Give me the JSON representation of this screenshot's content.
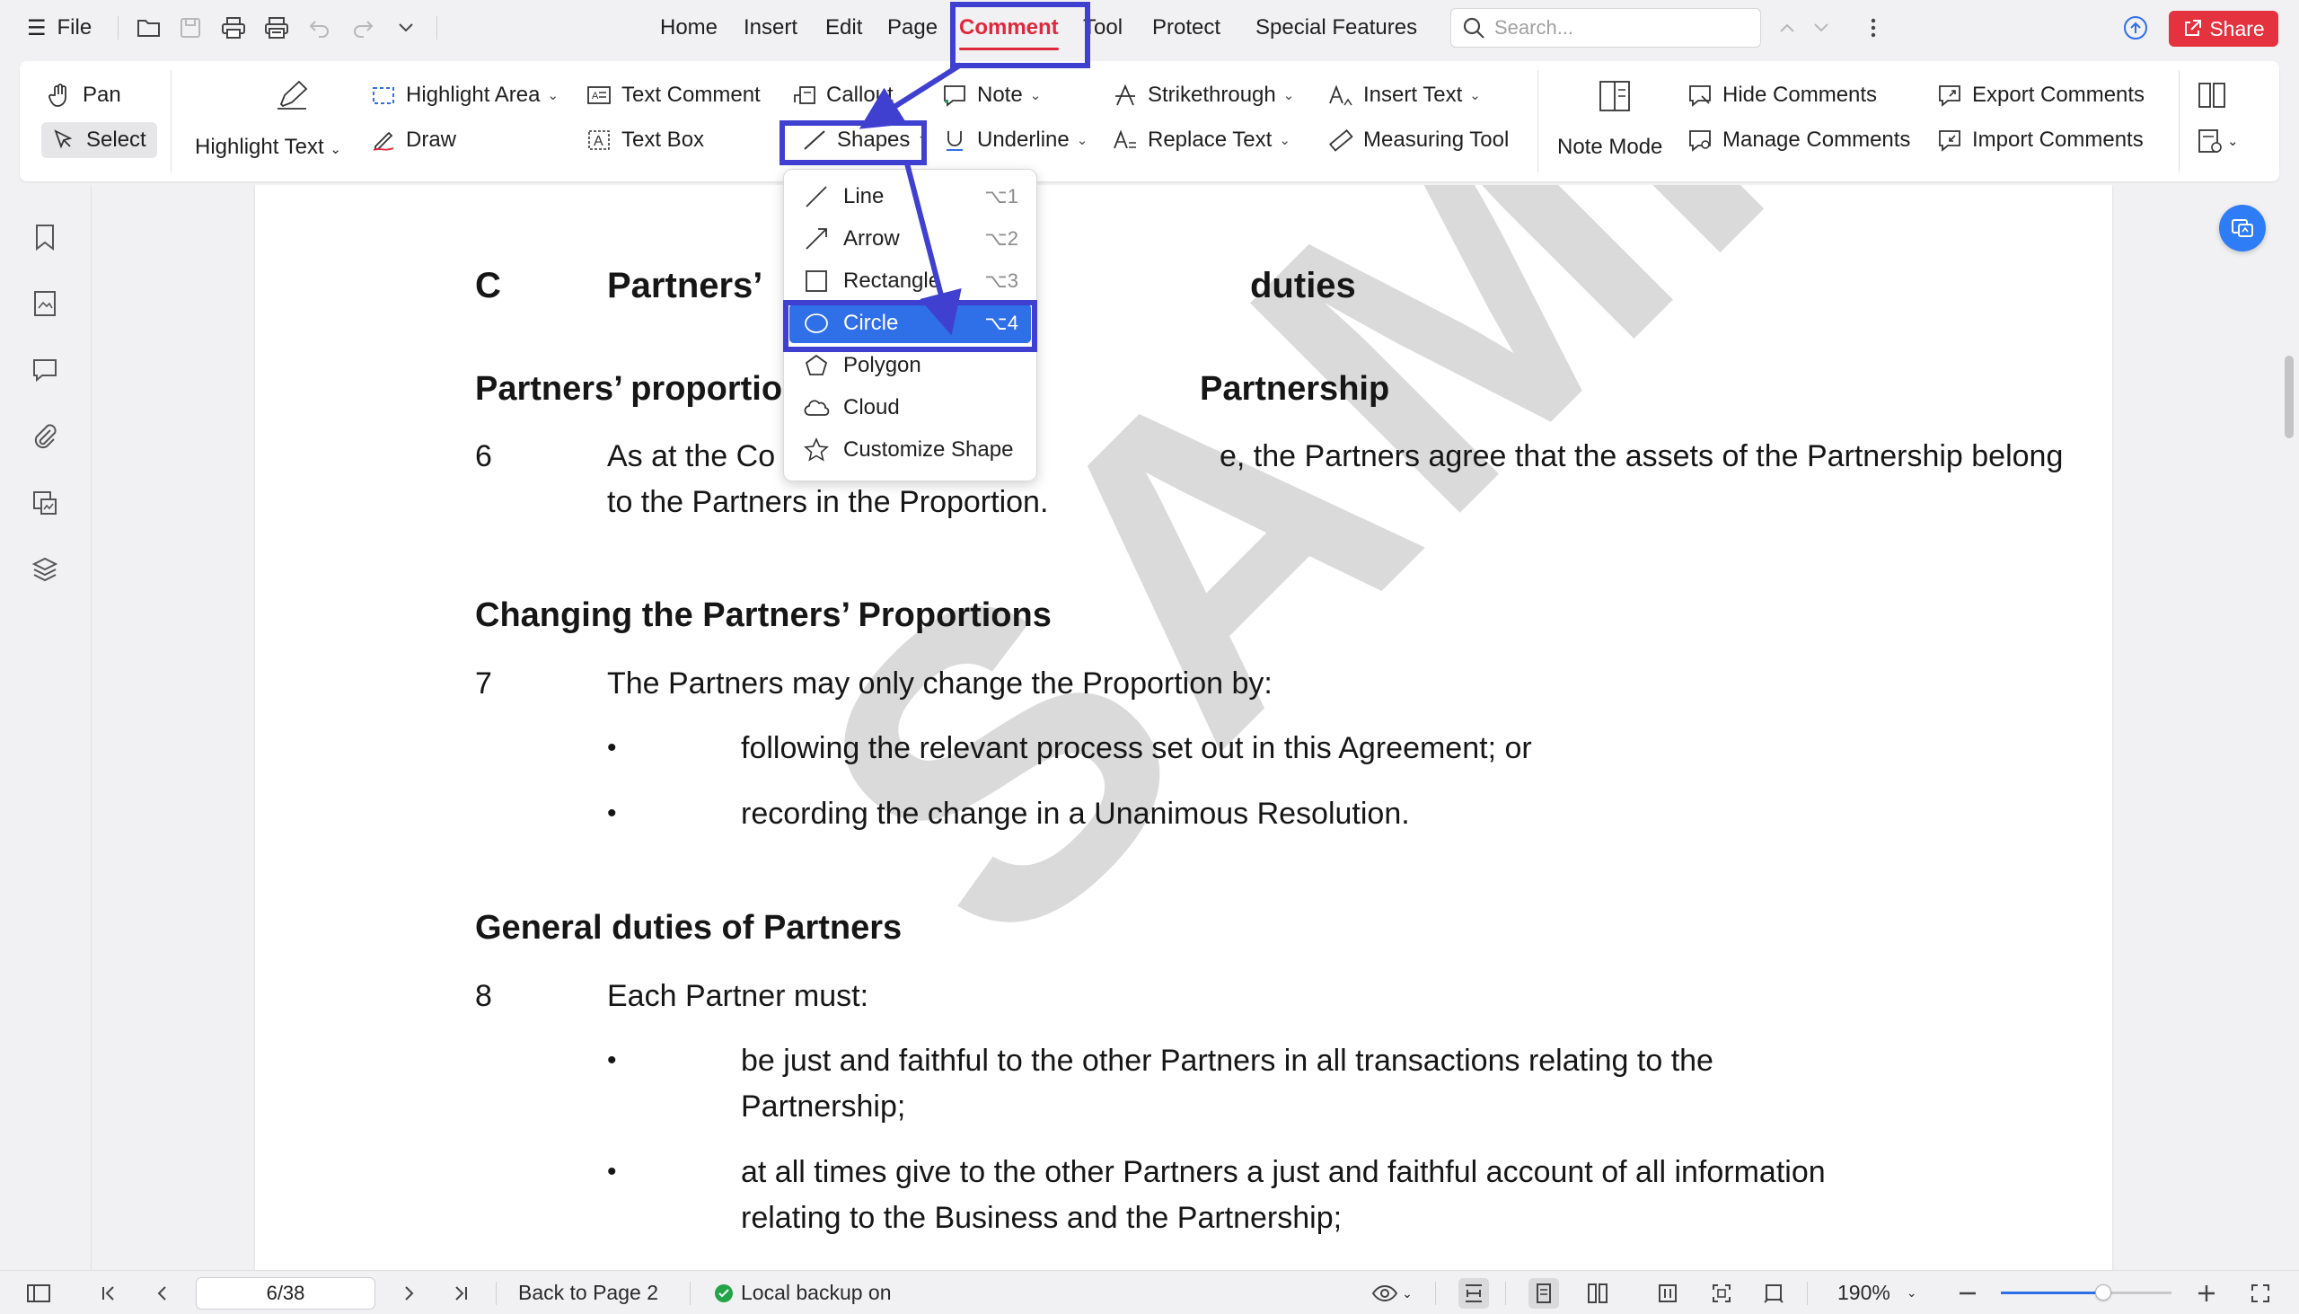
{
  "menubar": {
    "file_label": "File",
    "tabs": [
      "Home",
      "Insert",
      "Edit",
      "Page",
      "Comment",
      "Tool",
      "Protect",
      "Special Features"
    ],
    "active_tab": "Comment",
    "search_placeholder": "Search...",
    "share_label": "Share",
    "accent_color": "#e0283c"
  },
  "ribbon": {
    "pan": "Pan",
    "select": "Select",
    "highlight_text": "Highlight Text",
    "highlight_area": "Highlight Area",
    "draw": "Draw",
    "text_comment": "Text Comment",
    "text_box": "Text Box",
    "callout": "Callout",
    "shapes": "Shapes",
    "note": "Note",
    "underline": "Underline",
    "strikethrough": "Strikethrough",
    "replace_text": "Replace Text",
    "insert_text": "Insert Text",
    "measuring_tool": "Measuring Tool",
    "note_mode": "Note Mode",
    "hide_comments": "Hide Comments",
    "manage_comments": "Manage Comments",
    "export_comments": "Export Comments",
    "import_comments": "Import Comments"
  },
  "shapes_menu": {
    "items": [
      {
        "label": "Line",
        "shortcut": "⌥1",
        "icon": "line-icon"
      },
      {
        "label": "Arrow",
        "shortcut": "⌥2",
        "icon": "arrow-icon"
      },
      {
        "label": "Rectangle",
        "shortcut": "⌥3",
        "icon": "rectangle-icon"
      },
      {
        "label": "Circle",
        "shortcut": "⌥4",
        "icon": "circle-icon"
      },
      {
        "label": "Polygon",
        "shortcut": "",
        "icon": "polygon-icon"
      },
      {
        "label": "Cloud",
        "shortcut": "",
        "icon": "cloud-icon"
      },
      {
        "label": "Customize Shape",
        "shortcut": "",
        "icon": "star-icon"
      }
    ],
    "highlighted": "Circle",
    "highlight_color": "#2f6fe8"
  },
  "document": {
    "section_letter": "C",
    "section_title_left": "Partners’",
    "section_title_right": "duties",
    "heading1_left": "Partners’ proportio",
    "heading1_right": "Partnership",
    "p6_num": "6",
    "p6_line1_left": "As at the Co",
    "p6_line1_right": "e, the Partners agree that the assets of the Partnership belong",
    "p6_line2": "to the Partners in the Proportion.",
    "heading2": "Changing the Partners’ Proportions",
    "p7_num": "7",
    "p7_text": "The Partners may only change the Proportion by:",
    "p7_b1": "following the relevant process set out in this Agreement; or",
    "p7_b2": "recording the change in a Unanimous Resolution.",
    "heading3": "General duties of Partners",
    "p8_num": "8",
    "p8_text": "Each Partner must:",
    "p8_b1_l1": "be just and faithful to the other Partners in all transactions relating to the",
    "p8_b1_l2": "Partnership;",
    "p8_b2_l1": "at all times give to the other Partners a just and faithful account of all information",
    "p8_b2_l2": "relating to the Business and the Partnership;",
    "watermark": "SAMPLE"
  },
  "statusbar": {
    "page_value": "6/38",
    "back_label": "Back to Page 2",
    "backup_label": "Local backup on",
    "zoom_label": "190%",
    "zoom_fraction": 0.6
  },
  "annotation_color": "#3f3fd0"
}
